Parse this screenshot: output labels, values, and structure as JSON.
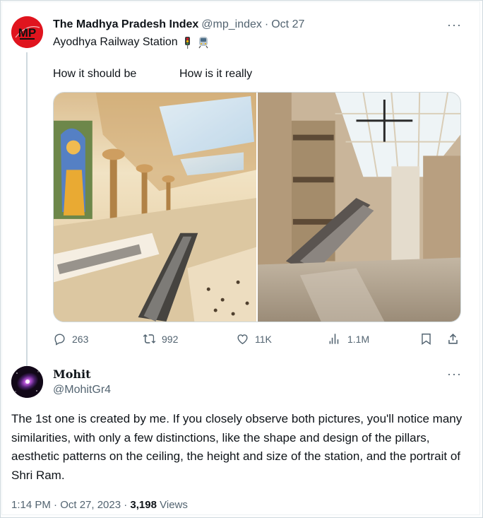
{
  "tweet": {
    "author_name": "The Madhya Pradesh Index",
    "author_handle": "@mp_index",
    "separator": "·",
    "date": "Oct 27",
    "avatar_text": "MP",
    "text": "Ayodhya Railway Station",
    "emojis": [
      "traffic-light-icon",
      "train-icon"
    ],
    "caption_left": "How it should be",
    "caption_right": "How is it really",
    "more_label": "···",
    "stats": {
      "replies": "263",
      "reposts": "992",
      "likes": "11K",
      "views": "1.1M"
    }
  },
  "reply": {
    "author_name": "Mohit",
    "author_handle": "@MohitGr4",
    "more_label": "···",
    "text": "The 1st one is created by me. If you closely observe both pictures, you'll notice many similarities, with only a few distinctions, like the shape and design of the pillars, aesthetic patterns on the ceiling, the height and size of the station, and the portrait of Shri Ram.",
    "time": "1:14 PM · Oct 27, 2023 · ",
    "views_count": "3,198",
    "views_label": " Views"
  },
  "colors": {
    "text": "#0f1419",
    "secondary": "#536471",
    "border": "#cfd9de",
    "brand_red": "#e0141e"
  }
}
